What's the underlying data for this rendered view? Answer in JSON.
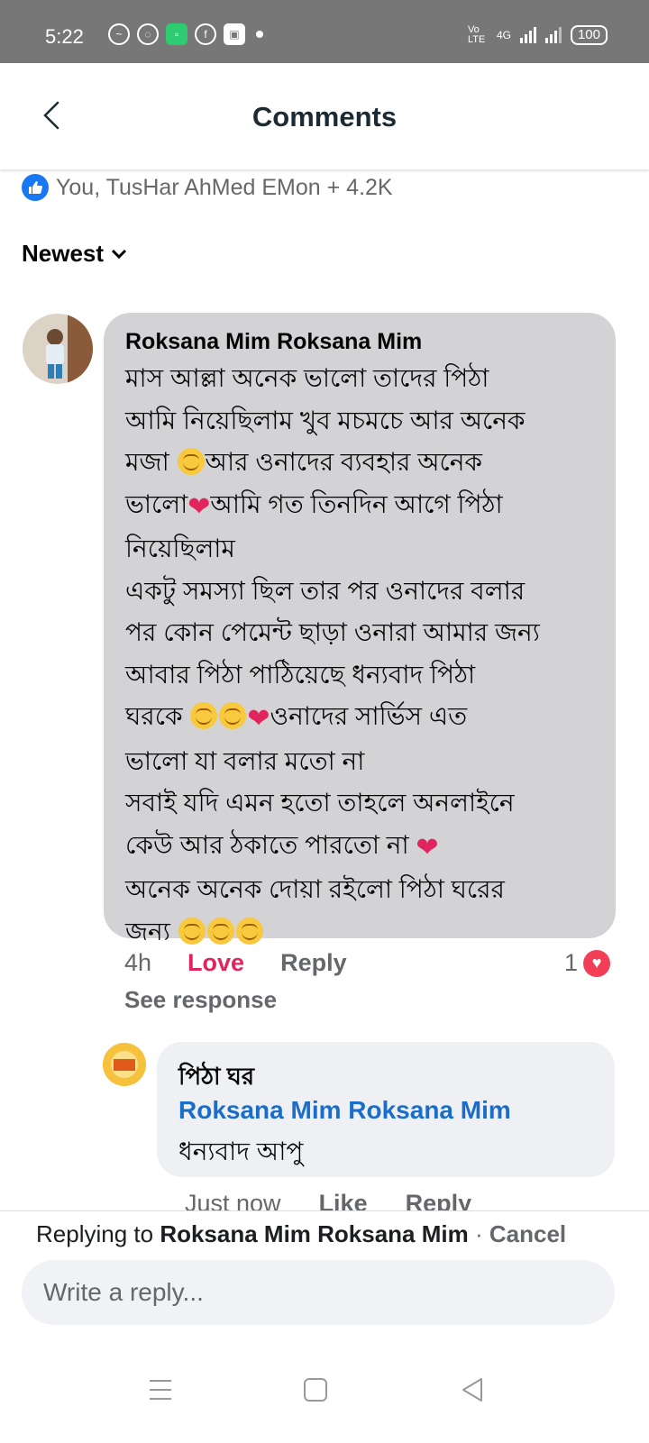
{
  "status_bar": {
    "time": "5:22",
    "network": "4G",
    "volte": "Vo LTE",
    "battery": "100"
  },
  "header": {
    "title": "Comments"
  },
  "reactions": {
    "summary": "You, TusHar AhMed EMon + 4.2K"
  },
  "sort": {
    "label": "Newest"
  },
  "comment": {
    "author": "Roksana Mim Roksana Mim",
    "lines": [
      "মাস আল্লা অনেক ভালো তাদের পিঠা",
      "আমি নিয়েছিলাম খুব মচমচে আর অনেক",
      "আর ওনাদের ব্যবহার অনেক",
      "আমি গত তিনদিন আগে পিঠা",
      "নিয়েছিলাম",
      "একটু সমস্যা ছিল তার পর ওনাদের বলার",
      "পর কোন পেমেন্ট ছাড়া ওনারা আমার জন্য",
      "আবার পিঠা পাঠিয়েছে ধন্যবাদ পিঠা",
      "ওনাদের সার্ভিস এত",
      "ভালো যা বলার মতো না",
      "সবাই যদি এমন হতো তাহলে অনলাইনে",
      "কেউ আর ঠকাতে পারতো না",
      "অনেক অনেক দোয়া রইলো পিঠা ঘরের"
    ],
    "prefix_line3": "মজা",
    "prefix_line4": "ভালো",
    "prefix_line9": "ঘরকে",
    "prefix_line14": "জন্য",
    "time": "4h",
    "love_label": "Love",
    "reply_label": "Reply",
    "reaction_count": "1",
    "see_response": "See response"
  },
  "reply": {
    "author": "পিঠা ঘর",
    "tag": "Roksana Mim Roksana Mim",
    "text": "ধন্যবাদ আপু",
    "time": "Just now",
    "like_label": "Like",
    "reply_label": "Reply"
  },
  "composer": {
    "replying_prefix": "Replying to",
    "replying_name": "Roksana Mim Roksana Mim",
    "separator": "·",
    "cancel_label": "Cancel",
    "placeholder": "Write a reply..."
  },
  "colors": {
    "accent_blue": "#1877f2",
    "love_red": "#e0245e",
    "bubble_gray": "#d3d3d6"
  }
}
